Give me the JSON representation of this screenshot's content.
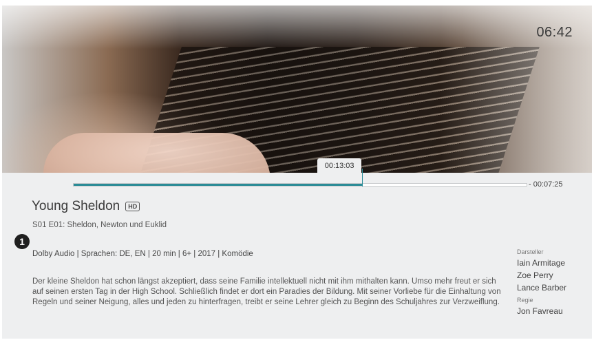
{
  "header": {
    "time": "06:42"
  },
  "player": {
    "current_time": "00:13:03",
    "remaining_time": "- 00:07:25",
    "progress_fraction": 0.637,
    "accent_color": "#2a8b96"
  },
  "show": {
    "title": "Young Sheldon",
    "quality_badge": "HD",
    "episode": "S01 E01: Sheldon, Newton und Euklid",
    "step_badge": "1",
    "meta": "Dolby Audio | Sprachen: DE, EN | 20 min | 6+ | 2017 | Komödie",
    "description": "Der kleine Sheldon hat schon längst akzeptiert, dass seine Familie intellektuell nicht mit ihm mithalten kann. Umso mehr freut er sich auf seinen ersten Tag in der High School. Schließlich findet er dort ein Paradies der Bildung. Mit seiner Vorliebe für die Einhaltung von Regeln und seiner Neigung, alles und jeden zu hinterfragen, treibt er seine Lehrer gleich zu Beginn des Schuljahres zur Verzweiflung."
  },
  "credits": {
    "cast_heading": "Darsteller",
    "cast": [
      "Iain Armitage",
      "Zoe Perry",
      "Lance Barber"
    ],
    "director_heading": "Regie",
    "director": "Jon Favreau"
  }
}
